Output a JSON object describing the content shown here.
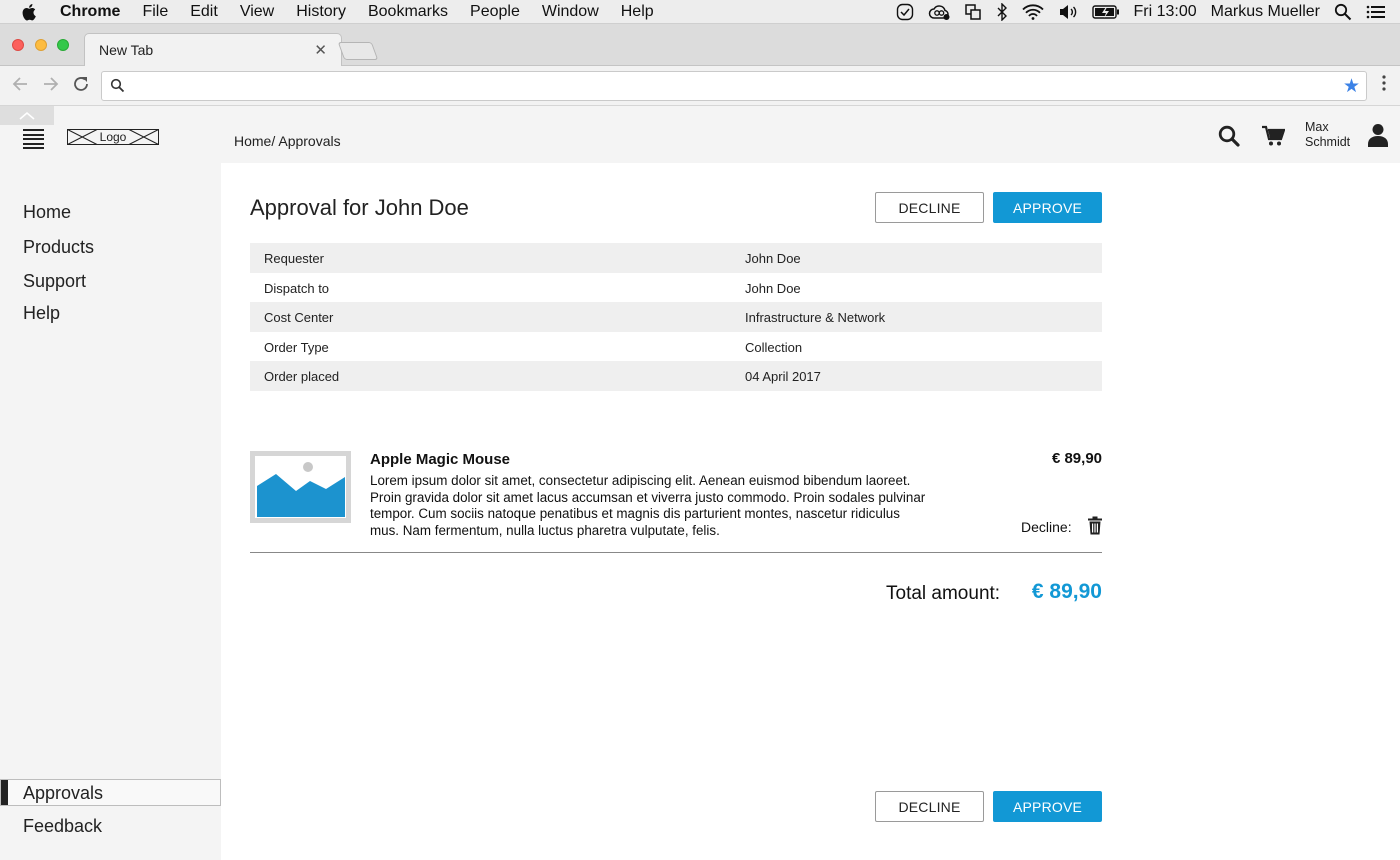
{
  "menubar": {
    "app_name": "Chrome",
    "items": [
      "File",
      "Edit",
      "View",
      "History",
      "Bookmarks",
      "People",
      "Window",
      "Help"
    ],
    "clock": "Fri 13:00",
    "user": "Markus Mueller"
  },
  "browser": {
    "tab_title": "New Tab",
    "url": "",
    "star_color": "#3c82e6"
  },
  "header": {
    "logo_text": "Logo",
    "breadcrumb": "Home/ Approvals",
    "user_first": "Max",
    "user_last": "Schmidt"
  },
  "sidebar": {
    "items": [
      "Home",
      "Products",
      "Support",
      "Help"
    ],
    "bottom": {
      "active": "Approvals",
      "feedback": "Feedback"
    }
  },
  "main": {
    "title": "Approval for John Doe",
    "decline_label": "DECLINE",
    "approve_label": "APPROVE",
    "details": [
      {
        "key": "Requester",
        "value": "John Doe"
      },
      {
        "key": "Dispatch to",
        "value": "John Doe"
      },
      {
        "key": "Cost Center",
        "value": "Infrastructure & Network"
      },
      {
        "key": "Order Type",
        "value": "Collection"
      },
      {
        "key": "Order placed",
        "value": "04 April 2017"
      }
    ],
    "item": {
      "name": "Apple Magic Mouse",
      "description": "Lorem ipsum dolor sit amet, consectetur adipiscing elit. Aenean euismod bibendum laoreet. Proin gravida dolor sit amet lacus accumsan et viverra justo commodo. Proin sodales pulvinar tempor. Cum sociis natoque penatibus et magnis dis parturient montes, nascetur ridiculus mus. Nam fermentum, nulla luctus pharetra vulputate, felis.",
      "price": "€ 89,90",
      "decline_label": "Decline:"
    },
    "total_label": "Total amount:",
    "total_value": "€ 89,90"
  },
  "colors": {
    "accent": "#1298d5",
    "sidebar_bg": "#f4f4f4"
  }
}
